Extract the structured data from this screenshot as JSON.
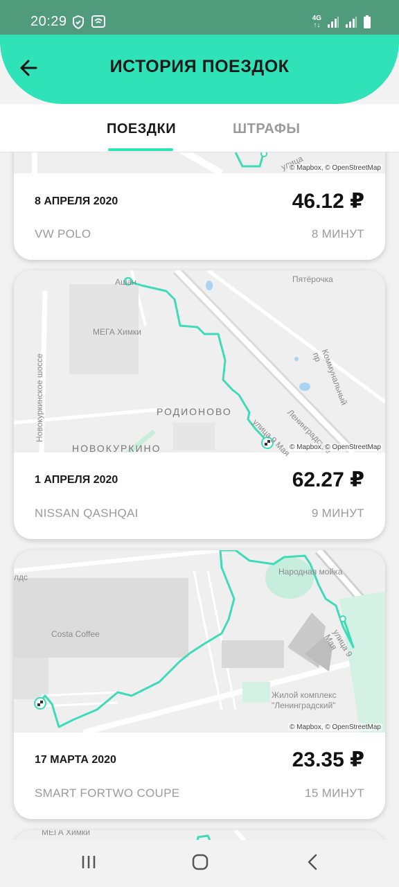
{
  "status": {
    "time": "20:29",
    "network": "4G"
  },
  "header": {
    "title": "ИСТОРИЯ ПОЕЗДОК"
  },
  "tabs": [
    {
      "label": "ПОЕЗДКИ"
    },
    {
      "label": "ШТРАФЫ"
    }
  ],
  "map_attribution": "© Mapbox, © OpenStreetMap",
  "trips": [
    {
      "date": "8 АПРЕЛЯ 2020",
      "price": "46.12 ₽",
      "car": "VW POLO",
      "duration": "8 МИНУТ",
      "map_labels": [
        "улица"
      ]
    },
    {
      "date": "1 АПРЕЛЯ 2020",
      "price": "62.27 ₽",
      "car": "NISSAN QASHQAI",
      "duration": "9 МИНУТ",
      "map_labels": [
        "Ашан",
        "Пятёрочка",
        "МЕГА Химки",
        "Коммунальный пр",
        "Новокуркинское шоссе",
        "РОДИОНОВО",
        "НОВОКУРКИНО",
        "улица 9 Мая",
        "Ленинградское"
      ]
    },
    {
      "date": "17 МАРТА 2020",
      "price": "23.35 ₽",
      "car": "SMART FORTWO COUPE",
      "duration": "15 МИНУТ",
      "map_labels": [
        "Народная мойка",
        "Costa Coffee",
        "улица 9 Мая",
        "Жилой комплекс",
        "\"Ленинградский\"",
        "лдс"
      ]
    }
  ],
  "partial_next_map_label": "МЕГА Химки",
  "colors": {
    "accent": "#2fe2b8",
    "status_bar": "#4f9b7b",
    "route": "#3ddbb7"
  },
  "nav": {
    "icons": [
      "recents-icon",
      "home-icon",
      "back-icon"
    ]
  }
}
